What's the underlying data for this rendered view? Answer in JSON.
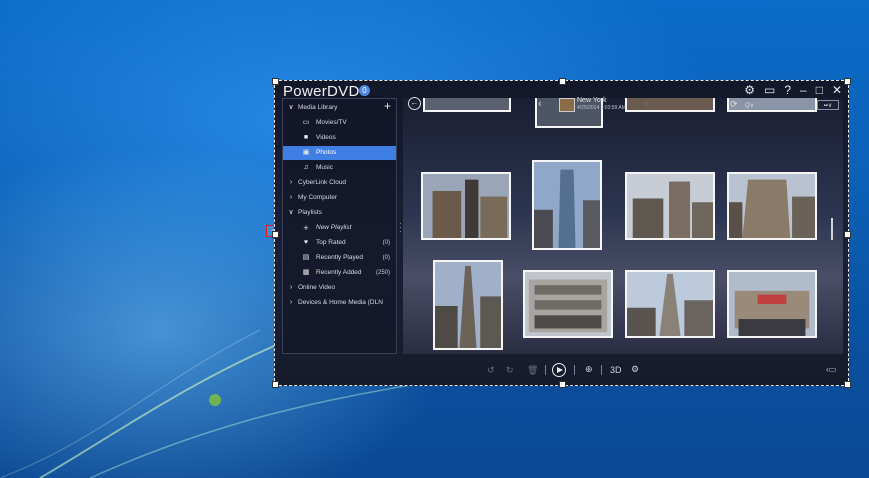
{
  "app": {
    "title": "PowerDVD",
    "badge": "0"
  },
  "window_controls": [
    "⚙",
    "▭",
    "?",
    "–",
    "□",
    "✕"
  ],
  "sidebar": {
    "add_label": "+",
    "items": [
      {
        "label": "Media Library",
        "icon": "chevron-down",
        "count": ""
      },
      {
        "label": "Movies/TV",
        "icon": "film-icon",
        "count": ""
      },
      {
        "label": "Videos",
        "icon": "video-camera-icon",
        "count": ""
      },
      {
        "label": "Photos",
        "icon": "photo-icon",
        "count": ""
      },
      {
        "label": "Music",
        "icon": "music-icon",
        "count": ""
      },
      {
        "label": "CyberLink Cloud",
        "icon": "chevron-right",
        "count": ""
      },
      {
        "label": "My Computer",
        "icon": "chevron-right",
        "count": ""
      },
      {
        "label": "Playlists",
        "icon": "chevron-down",
        "count": ""
      },
      {
        "label": "New Playlist",
        "icon": "plus-icon",
        "count": ""
      },
      {
        "label": "Top Rated",
        "icon": "heart-icon",
        "count": "(0)"
      },
      {
        "label": "Recently Played",
        "icon": "recent-played-icon",
        "count": "(0)"
      },
      {
        "label": "Recently Added",
        "icon": "recent-added-icon",
        "count": "(250)"
      },
      {
        "label": "Online Video",
        "icon": "chevron-right",
        "count": ""
      },
      {
        "label": "Devices & Home Media (DLN",
        "icon": "chevron-right",
        "count": ""
      }
    ]
  },
  "location": {
    "name": "New York",
    "date": "4/25/2014 9:03:59 AM"
  },
  "search": {
    "placeholder": "Q∨"
  },
  "view_button": "▪▪∨",
  "bottom": {
    "label_3d": "3D"
  },
  "colors": {
    "accent": "#3f7fe3",
    "window_bg": "#161b2c",
    "desktop": "#0c5fb6",
    "highlight_box": "#e02020"
  }
}
